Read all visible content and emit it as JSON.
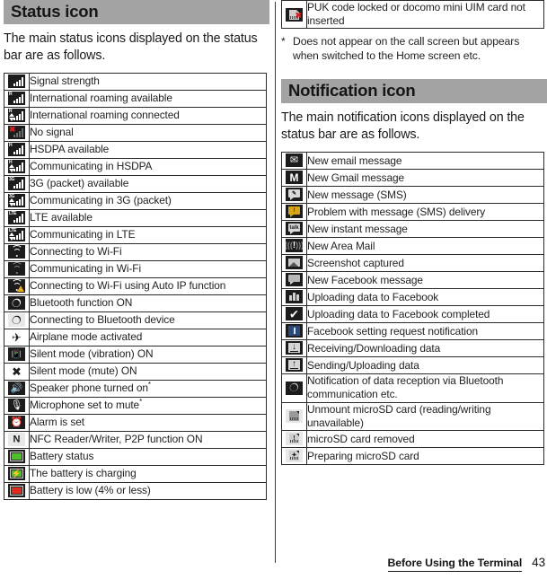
{
  "footer": {
    "chapter": "Before Using the Terminal",
    "page_number": "43"
  },
  "left_column": {
    "section": {
      "title": "Status icon",
      "intro": "The main status icons displayed on the status bar are as follows."
    },
    "rows": [
      {
        "icon": "signal-strength-icon",
        "label": "Signal strength"
      },
      {
        "icon": "international-roaming-available-icon",
        "label": "International roaming available"
      },
      {
        "icon": "international-roaming-connected-icon",
        "label": "International roaming connected"
      },
      {
        "icon": "no-signal-icon",
        "label": "No signal"
      },
      {
        "icon": "hsdpa-available-icon",
        "label": "HSDPA available"
      },
      {
        "icon": "hsdpa-communicating-icon",
        "label": "Communicating in HSDPA"
      },
      {
        "icon": "3g-packet-available-icon",
        "label": "3G (packet) available"
      },
      {
        "icon": "3g-packet-communicating-icon",
        "label": "Communicating in 3G (packet)"
      },
      {
        "icon": "lte-available-icon",
        "label": "LTE available"
      },
      {
        "icon": "lte-communicating-icon",
        "label": "Communicating in LTE"
      },
      {
        "icon": "wifi-connecting-icon",
        "label": "Connecting to Wi-Fi"
      },
      {
        "icon": "wifi-communicating-icon",
        "label": "Communicating in Wi-Fi"
      },
      {
        "icon": "wifi-auto-ip-icon",
        "label": "Connecting to Wi-Fi using Auto IP function"
      },
      {
        "icon": "bluetooth-on-icon",
        "label": "Bluetooth function ON"
      },
      {
        "icon": "bluetooth-connecting-icon",
        "label": "Connecting to Bluetooth device"
      },
      {
        "icon": "airplane-mode-icon",
        "label": "Airplane mode activated"
      },
      {
        "icon": "silent-vibration-icon",
        "label": "Silent mode (vibration) ON"
      },
      {
        "icon": "silent-mute-icon",
        "label": "Silent mode (mute) ON"
      },
      {
        "icon": "speaker-phone-icon",
        "label": "Speaker phone turned on",
        "footnote": "*"
      },
      {
        "icon": "microphone-mute-icon",
        "label": "Microphone set to mute",
        "footnote": "*"
      },
      {
        "icon": "alarm-set-icon",
        "label": "Alarm is set"
      },
      {
        "icon": "nfc-reader-writer-icon",
        "label": "NFC Reader/Writer, P2P function ON"
      },
      {
        "icon": "battery-status-icon",
        "label": "Battery status"
      },
      {
        "icon": "battery-charging-icon",
        "label": "The battery is charging"
      },
      {
        "icon": "battery-low-icon",
        "label": "Battery is low (4% or less)"
      }
    ]
  },
  "right_column": {
    "top_rows": [
      {
        "icon": "puk-locked-icon",
        "label": "PUK code locked or docomo mini UIM card not inserted"
      }
    ],
    "footnote": {
      "marker": "*",
      "text": "Does not appear on the call screen but appears when switched to the Home screen etc."
    },
    "section": {
      "title": "Notification icon",
      "intro": "The main notification icons displayed on the status bar are as follows."
    },
    "rows": [
      {
        "icon": "new-email-icon",
        "label": "New email message"
      },
      {
        "icon": "new-gmail-icon",
        "label": "New Gmail message"
      },
      {
        "icon": "new-sms-icon",
        "label": "New message (SMS)"
      },
      {
        "icon": "sms-delivery-problem-icon",
        "label": "Problem with message (SMS) delivery"
      },
      {
        "icon": "new-instant-message-icon",
        "label": "New instant message"
      },
      {
        "icon": "new-area-mail-icon",
        "label": "New Area Mail"
      },
      {
        "icon": "screenshot-captured-icon",
        "label": "Screenshot captured"
      },
      {
        "icon": "new-facebook-message-icon",
        "label": "New Facebook message"
      },
      {
        "icon": "facebook-uploading-icon",
        "label": "Uploading data to Facebook"
      },
      {
        "icon": "facebook-upload-complete-icon",
        "label": "Uploading data to Facebook completed"
      },
      {
        "icon": "facebook-setting-request-icon",
        "label": "Facebook setting request notification"
      },
      {
        "icon": "downloading-data-icon",
        "label": "Receiving/Downloading data"
      },
      {
        "icon": "uploading-data-icon",
        "label": "Sending/Uploading data"
      },
      {
        "icon": "bluetooth-data-reception-icon",
        "label": "Notification of data reception via Bluetooth communication etc."
      },
      {
        "icon": "microsd-unmount-icon",
        "label": "Unmount microSD card (reading/writing unavailable)"
      },
      {
        "icon": "microsd-removed-icon",
        "label": "microSD card removed"
      },
      {
        "icon": "microsd-preparing-icon",
        "label": "Preparing microSD card"
      }
    ]
  },
  "colors": {
    "section_bar": "#a3a3a3",
    "icon_dark": "#1c1c1c",
    "battery_green": "#4fbf28",
    "battery_red": "#e02a1c",
    "sms_problem_gold": "#d8a516",
    "warning_amber": "#e8b020",
    "no_signal_red": "#d8201e",
    "facebook_blue": "#2b4a7a"
  }
}
